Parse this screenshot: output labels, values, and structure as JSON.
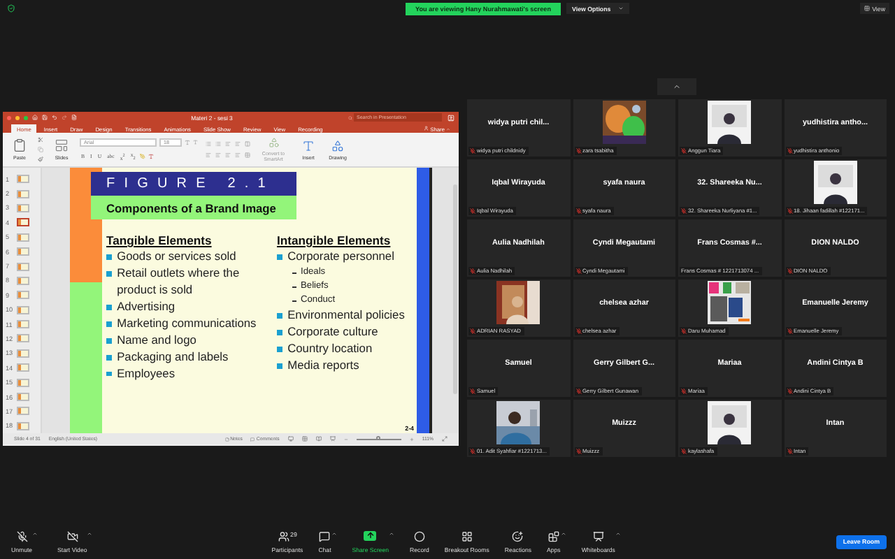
{
  "top_bar": {
    "banner": "You are viewing Hany Nurahmawati's screen",
    "view_options": "View Options",
    "view": "View"
  },
  "presentation": {
    "title": "Materi 2 - sesi 3",
    "search": {
      "placeholder": "Search in Presentation"
    },
    "tabs": [
      {
        "label": "Home",
        "selected": true
      },
      {
        "label": "Insert",
        "selected": false
      },
      {
        "label": "Draw",
        "selected": false
      },
      {
        "label": "Design",
        "selected": false
      },
      {
        "label": "Transitions",
        "selected": false
      },
      {
        "label": "Animations",
        "selected": false
      },
      {
        "label": "Slide Show",
        "selected": false
      },
      {
        "label": "Review",
        "selected": false
      },
      {
        "label": "View",
        "selected": false
      },
      {
        "label": "Recording",
        "selected": false
      }
    ],
    "share": "Share",
    "ribbon": {
      "paste": "Paste",
      "slides": "Slides",
      "font": "Arial",
      "size": "18",
      "format_buttons": [
        "B",
        "I",
        "U",
        "abc",
        "x$^{2}$",
        "x$_{2}$"
      ],
      "smartart": "Convert to SmartArt",
      "insert": "Insert",
      "drawing": "Drawing"
    },
    "thumbnails": [
      {
        "number": "1",
        "selected": false
      },
      {
        "number": "2",
        "selected": false
      },
      {
        "number": "3",
        "selected": false
      },
      {
        "number": "4",
        "selected": true
      },
      {
        "number": "5",
        "selected": false
      },
      {
        "number": "6",
        "selected": false
      },
      {
        "number": "7",
        "selected": false
      },
      {
        "number": "8",
        "selected": false
      },
      {
        "number": "9",
        "selected": false
      },
      {
        "number": "10",
        "selected": false
      },
      {
        "number": "11",
        "selected": false
      },
      {
        "number": "12",
        "selected": false
      },
      {
        "number": "13",
        "selected": false
      },
      {
        "number": "14",
        "selected": false
      },
      {
        "number": "15",
        "selected": false
      },
      {
        "number": "16",
        "selected": false
      },
      {
        "number": "17",
        "selected": false
      },
      {
        "number": "18",
        "selected": false
      }
    ],
    "slide": {
      "figure": "FIGURE 2.1",
      "caption": "Components of a Brand Image",
      "columns": [
        {
          "heading": "Tangible Elements",
          "items": [
            {
              "text": "Goods or services sold"
            },
            {
              "text": "Retail outlets where the product is sold"
            },
            {
              "text": "Advertising"
            },
            {
              "text": "Marketing communications"
            },
            {
              "text": "Name and logo"
            },
            {
              "text": "Packaging and labels"
            },
            {
              "text": "Employees"
            }
          ]
        },
        {
          "heading": "Intangible Elements",
          "items": [
            {
              "text": "Corporate personnel",
              "children": [
                {
                  "text": "Ideals"
                },
                {
                  "text": "Beliefs"
                },
                {
                  "text": "Conduct"
                }
              ]
            },
            {
              "text": "Environmental policies"
            },
            {
              "text": "Corporate culture"
            },
            {
              "text": "Country location"
            },
            {
              "text": "Media reports"
            }
          ]
        }
      ],
      "page": "2-4"
    },
    "status": {
      "slide": "Slide 4 of 31",
      "language": "English (United States)",
      "notes": "Notes",
      "comments": "Comments",
      "zoom_slider": {
        "level": 0.5
      },
      "zoom": "111%"
    }
  },
  "gallery": {
    "tiles": [
      {
        "kind": "name",
        "name": "widya putri chil...",
        "label": "widya putri childnidy",
        "muted": true
      },
      {
        "kind": "picture",
        "label": "zara tsabitha",
        "muted": true
      },
      {
        "kind": "picture",
        "label": "Anggun Tiara",
        "muted": true
      },
      {
        "kind": "name",
        "name": "yudhistira antho...",
        "label": "yudhistira anthonio",
        "muted": true
      },
      {
        "kind": "name",
        "name": "Iqbal Wirayuda",
        "label": "Iqbal Wirayuda",
        "muted": true
      },
      {
        "kind": "name",
        "name": "syafa naura",
        "label": "syafa naura",
        "muted": true
      },
      {
        "kind": "name",
        "name": "32. Shareeka Nu...",
        "label": "32. Shareeka Nurliyana #1...",
        "muted": true
      },
      {
        "kind": "picture",
        "label": "18. Jihaan fadillah #122171...",
        "muted": true
      },
      {
        "kind": "name",
        "name": "Aulia Nadhilah",
        "label": "Aulia Nadhilah",
        "muted": true
      },
      {
        "kind": "name",
        "name": "Cyndi Megautami",
        "label": "Cyndi Megautami",
        "muted": true
      },
      {
        "kind": "name",
        "name": "Frans Cosmas #...",
        "label": "Frans Cosmas # 1221713074 ...",
        "muted": false
      },
      {
        "kind": "name",
        "name": "DION NALDO",
        "label": "DION NALDO",
        "muted": true
      },
      {
        "kind": "picture",
        "label": "ADRIAN RASYAD",
        "muted": true
      },
      {
        "kind": "name",
        "name": "chelsea azhar",
        "label": "chelsea azhar",
        "muted": true
      },
      {
        "kind": "picture",
        "label": "Daru Muhamad",
        "muted": true
      },
      {
        "kind": "name",
        "name": "Emanuelle Jeremy",
        "label": "Emanuelle Jeremy",
        "muted": true
      },
      {
        "kind": "name",
        "name": "Samuel",
        "label": "Samuel",
        "muted": true
      },
      {
        "kind": "name",
        "name": "Gerry Gilbert G...",
        "label": "Gerry Gilbert Gunawan",
        "muted": true
      },
      {
        "kind": "name",
        "name": "Mariaa",
        "label": "Mariaa",
        "muted": true
      },
      {
        "kind": "name",
        "name": "Andini Cintya B",
        "label": "Andini Cintya B",
        "muted": true
      },
      {
        "kind": "picture",
        "label": "01. Adit Syahfiar #1221713...",
        "muted": true
      },
      {
        "kind": "name",
        "name": "Muizzz",
        "label": "Muizzz",
        "muted": true
      },
      {
        "kind": "picture",
        "label": "kaylashafa",
        "muted": true
      },
      {
        "kind": "name",
        "name": "Intan",
        "label": "Intan",
        "muted": true
      }
    ]
  },
  "toolbar": {
    "items": [
      {
        "kind": "mic",
        "label": "Unmute",
        "caret": true,
        "active": false
      },
      {
        "kind": "video",
        "label": "Start Video",
        "caret": true,
        "active": false
      },
      {
        "kind": "participants",
        "label": "Participants",
        "count": "29",
        "caret": false,
        "active": false
      },
      {
        "kind": "chat",
        "label": "Chat",
        "caret": true,
        "active": false
      },
      {
        "kind": "share",
        "label": "Share Screen",
        "caret": true,
        "active": true
      },
      {
        "kind": "record",
        "label": "Record",
        "caret": false,
        "active": false
      },
      {
        "kind": "breakout",
        "label": "Breakout Rooms",
        "caret": false,
        "active": false
      },
      {
        "kind": "reactions",
        "label": "Reactions",
        "caret": false,
        "active": false
      },
      {
        "kind": "apps",
        "label": "Apps",
        "caret": true,
        "active": false
      },
      {
        "kind": "whiteboards",
        "label": "Whiteboards",
        "caret": true,
        "active": false
      }
    ],
    "leave": "Leave Room"
  }
}
